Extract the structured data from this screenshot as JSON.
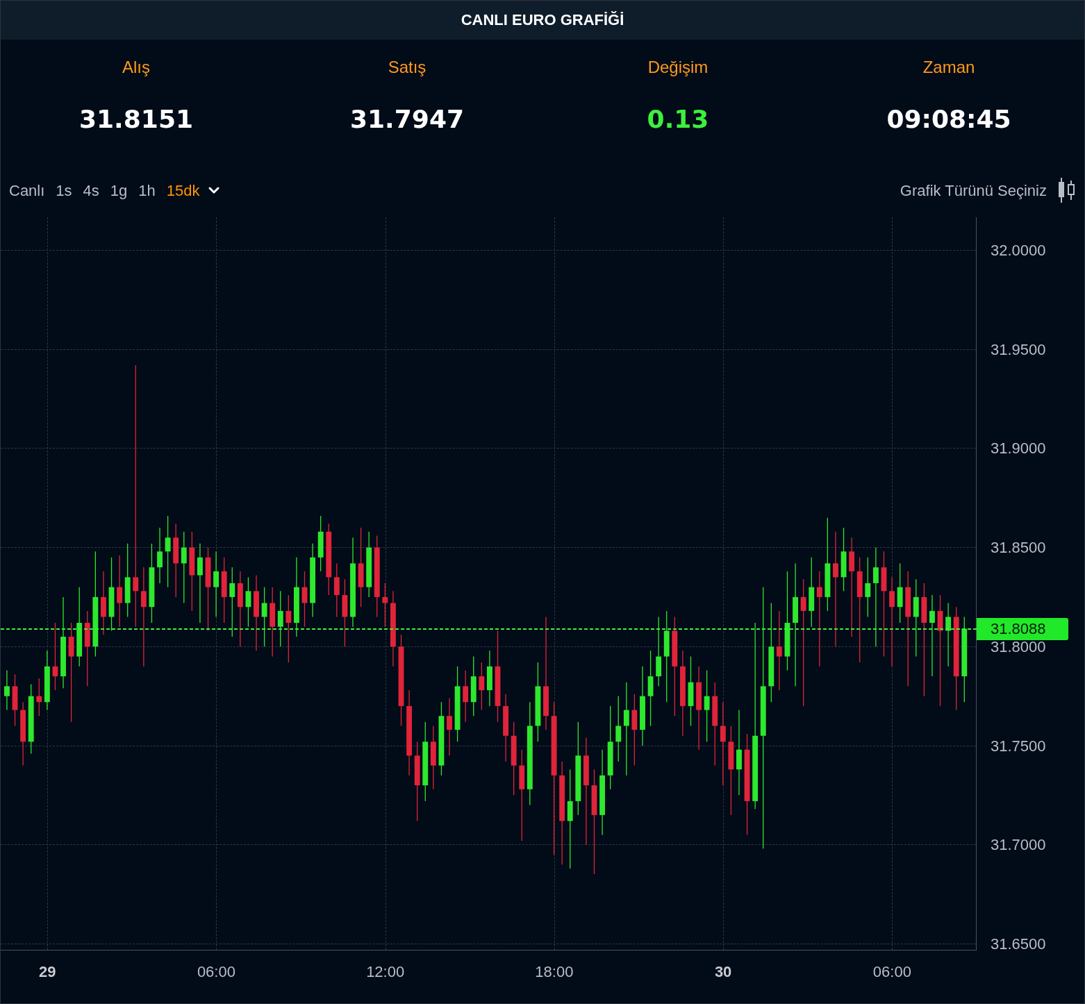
{
  "window": {
    "title": "CANLI EURO GRAFİĞİ"
  },
  "stats": [
    {
      "label": "Alış",
      "value": "31.8151",
      "kind": "plain"
    },
    {
      "label": "Satış",
      "value": "31.7947",
      "kind": "plain"
    },
    {
      "label": "Değişim",
      "value": "0.13",
      "kind": "up"
    },
    {
      "label": "Zaman",
      "value": "09:08:45",
      "kind": "plain"
    }
  ],
  "intervals": [
    {
      "label": "Canlı",
      "selected": false
    },
    {
      "label": "1s",
      "selected": false
    },
    {
      "label": "4s",
      "selected": false
    },
    {
      "label": "1g",
      "selected": false
    },
    {
      "label": "1h",
      "selected": false
    },
    {
      "label": "15dk",
      "selected": true
    }
  ],
  "chart_type_label": "Grafik Türünü Seçiniz",
  "xtick_styles": [
    {
      "bold": true
    },
    {
      "bold": false
    },
    {
      "bold": false
    },
    {
      "bold": false
    },
    {
      "bold": true
    },
    {
      "bold": false
    }
  ],
  "chart_data": {
    "type": "candlestick",
    "grid": true,
    "ref_lines": [
      {
        "axis": "y",
        "value": 31.8088,
        "label": "31.8088",
        "color": "#3cf03c"
      }
    ],
    "ylim": [
      31.65,
      32.0165
    ],
    "categories": [
      null,
      null,
      null,
      null,
      null,
      "29",
      null,
      null,
      null,
      null,
      null,
      null,
      null,
      null,
      null,
      null,
      null,
      null,
      null,
      null,
      null,
      null,
      null,
      null,
      null,
      null,
      "06:00",
      null,
      null,
      null,
      null,
      null,
      null,
      null,
      null,
      null,
      null,
      null,
      null,
      null,
      null,
      null,
      null,
      null,
      null,
      null,
      null,
      "12:00",
      null,
      null,
      null,
      null,
      null,
      null,
      null,
      null,
      null,
      null,
      null,
      null,
      null,
      null,
      null,
      null,
      null,
      null,
      null,
      null,
      "18:00",
      null,
      null,
      null,
      null,
      null,
      null,
      null,
      null,
      null,
      null,
      null,
      null,
      null,
      null,
      null,
      null,
      null,
      null,
      null,
      null,
      "30",
      null,
      null,
      null,
      null,
      null,
      null,
      null,
      null,
      null,
      null,
      null,
      null,
      null,
      null,
      null,
      null,
      null,
      null,
      null,
      null,
      "06:00",
      null,
      null,
      null,
      null,
      null,
      null,
      null,
      null,
      null
    ],
    "yticks": [
      {
        "value": 32.0,
        "label": "32.0000"
      },
      {
        "value": 31.95,
        "label": "31.9500"
      },
      {
        "value": 31.9,
        "label": "31.9000"
      },
      {
        "value": 31.85,
        "label": "31.8500"
      },
      {
        "value": 31.8,
        "label": "31.8000"
      },
      {
        "value": 31.75,
        "label": "31.7500"
      },
      {
        "value": 31.7,
        "label": "31.7000"
      },
      {
        "value": 31.65,
        "label": "31.6500"
      }
    ],
    "ohlc": [
      [
        31.775,
        31.788,
        31.768,
        31.78
      ],
      [
        31.78,
        31.786,
        31.76,
        31.768
      ],
      [
        31.768,
        31.772,
        31.74,
        31.752
      ],
      [
        31.752,
        31.781,
        31.746,
        31.775
      ],
      [
        31.775,
        31.784,
        31.765,
        31.772
      ],
      [
        31.772,
        31.798,
        31.768,
        31.79
      ],
      [
        31.79,
        31.812,
        31.778,
        31.785
      ],
      [
        31.785,
        31.825,
        31.779,
        31.805
      ],
      [
        31.805,
        31.812,
        31.762,
        31.795
      ],
      [
        31.795,
        31.83,
        31.79,
        31.812
      ],
      [
        31.812,
        31.818,
        31.78,
        31.8
      ],
      [
        31.8,
        31.848,
        31.795,
        31.825
      ],
      [
        31.825,
        31.838,
        31.806,
        31.815
      ],
      [
        31.815,
        31.845,
        31.808,
        31.83
      ],
      [
        31.83,
        31.846,
        31.81,
        31.822
      ],
      [
        31.822,
        31.852,
        31.815,
        31.835
      ],
      [
        31.835,
        31.942,
        31.81,
        31.828
      ],
      [
        31.828,
        31.84,
        31.79,
        31.82
      ],
      [
        31.82,
        31.852,
        31.812,
        31.84
      ],
      [
        31.84,
        31.86,
        31.832,
        31.848
      ],
      [
        31.848,
        31.866,
        31.83,
        31.855
      ],
      [
        31.855,
        31.862,
        31.825,
        31.842
      ],
      [
        31.842,
        31.858,
        31.822,
        31.85
      ],
      [
        31.85,
        31.858,
        31.818,
        31.836
      ],
      [
        31.836,
        31.852,
        31.812,
        31.845
      ],
      [
        31.845,
        31.85,
        31.808,
        31.83
      ],
      [
        31.83,
        31.848,
        31.815,
        31.838
      ],
      [
        31.838,
        31.845,
        31.812,
        31.825
      ],
      [
        31.825,
        31.84,
        31.805,
        31.832
      ],
      [
        31.832,
        31.838,
        31.8,
        31.82
      ],
      [
        31.82,
        31.835,
        31.81,
        31.828
      ],
      [
        31.828,
        31.836,
        31.798,
        31.815
      ],
      [
        31.815,
        31.83,
        31.8,
        31.822
      ],
      [
        31.822,
        31.83,
        31.795,
        31.81
      ],
      [
        31.81,
        31.828,
        31.8,
        31.818
      ],
      [
        31.818,
        31.826,
        31.792,
        31.812
      ],
      [
        31.812,
        31.845,
        31.805,
        31.83
      ],
      [
        31.83,
        31.838,
        31.81,
        31.822
      ],
      [
        31.822,
        31.852,
        31.815,
        31.845
      ],
      [
        31.845,
        31.866,
        31.838,
        31.858
      ],
      [
        31.858,
        31.862,
        31.826,
        31.835
      ],
      [
        31.835,
        31.842,
        31.815,
        31.826
      ],
      [
        31.826,
        31.834,
        31.8,
        31.815
      ],
      [
        31.815,
        31.855,
        31.81,
        31.842
      ],
      [
        31.842,
        31.86,
        31.82,
        31.83
      ],
      [
        31.83,
        31.858,
        31.825,
        31.85
      ],
      [
        31.85,
        31.856,
        31.815,
        31.825
      ],
      [
        31.825,
        31.832,
        31.81,
        31.822
      ],
      [
        31.822,
        31.828,
        31.79,
        31.8
      ],
      [
        31.8,
        31.806,
        31.76,
        31.77
      ],
      [
        31.77,
        31.778,
        31.735,
        31.745
      ],
      [
        31.745,
        31.752,
        31.712,
        31.73
      ],
      [
        31.73,
        31.762,
        31.722,
        31.752
      ],
      [
        31.752,
        31.76,
        31.728,
        31.74
      ],
      [
        31.74,
        31.772,
        31.735,
        31.765
      ],
      [
        31.765,
        31.774,
        31.745,
        31.758
      ],
      [
        31.758,
        31.79,
        31.752,
        31.78
      ],
      [
        31.78,
        31.788,
        31.762,
        31.772
      ],
      [
        31.772,
        31.795,
        31.765,
        31.785
      ],
      [
        31.785,
        31.792,
        31.768,
        31.778
      ],
      [
        31.778,
        31.798,
        31.77,
        31.79
      ],
      [
        31.79,
        31.808,
        31.762,
        31.77
      ],
      [
        31.77,
        31.776,
        31.742,
        31.755
      ],
      [
        31.755,
        31.762,
        31.725,
        31.74
      ],
      [
        31.74,
        31.748,
        31.702,
        31.728
      ],
      [
        31.728,
        31.772,
        31.72,
        31.76
      ],
      [
        31.76,
        31.792,
        31.752,
        31.78
      ],
      [
        31.78,
        31.815,
        31.758,
        31.765
      ],
      [
        31.765,
        31.772,
        31.695,
        31.735
      ],
      [
        31.735,
        31.742,
        31.69,
        31.712
      ],
      [
        31.712,
        31.738,
        31.688,
        31.722
      ],
      [
        31.722,
        31.762,
        31.715,
        31.745
      ],
      [
        31.745,
        31.754,
        31.7,
        31.73
      ],
      [
        31.73,
        31.738,
        31.685,
        31.715
      ],
      [
        31.715,
        31.748,
        31.705,
        31.735
      ],
      [
        31.735,
        31.77,
        31.728,
        31.752
      ],
      [
        31.752,
        31.775,
        31.742,
        31.76
      ],
      [
        31.76,
        31.782,
        31.735,
        31.768
      ],
      [
        31.768,
        31.776,
        31.74,
        31.758
      ],
      [
        31.758,
        31.79,
        31.75,
        31.775
      ],
      [
        31.775,
        31.798,
        31.76,
        31.785
      ],
      [
        31.785,
        31.815,
        31.78,
        31.795
      ],
      [
        31.795,
        31.818,
        31.772,
        31.808
      ],
      [
        31.808,
        31.815,
        31.765,
        31.79
      ],
      [
        31.79,
        31.798,
        31.755,
        31.77
      ],
      [
        31.77,
        31.795,
        31.76,
        31.782
      ],
      [
        31.782,
        31.79,
        31.748,
        31.768
      ],
      [
        31.768,
        31.788,
        31.752,
        31.775
      ],
      [
        31.775,
        31.782,
        31.74,
        31.76
      ],
      [
        31.76,
        31.772,
        31.73,
        31.752
      ],
      [
        31.752,
        31.76,
        31.715,
        31.738
      ],
      [
        31.738,
        31.768,
        31.725,
        31.748
      ],
      [
        31.748,
        31.756,
        31.705,
        31.722
      ],
      [
        31.722,
        31.812,
        31.718,
        31.755
      ],
      [
        31.755,
        31.83,
        31.698,
        31.78
      ],
      [
        31.78,
        31.822,
        31.772,
        31.8
      ],
      [
        31.8,
        31.818,
        31.778,
        31.795
      ],
      [
        31.795,
        31.838,
        31.788,
        31.812
      ],
      [
        31.812,
        31.842,
        31.78,
        31.825
      ],
      [
        31.825,
        31.834,
        31.77,
        31.818
      ],
      [
        31.818,
        31.845,
        31.81,
        31.83
      ],
      [
        31.83,
        31.838,
        31.79,
        31.825
      ],
      [
        31.825,
        31.865,
        31.818,
        31.842
      ],
      [
        31.842,
        31.858,
        31.8,
        31.835
      ],
      [
        31.835,
        31.86,
        31.828,
        31.848
      ],
      [
        31.848,
        31.855,
        31.805,
        31.838
      ],
      [
        31.838,
        31.845,
        31.792,
        31.825
      ],
      [
        31.825,
        31.845,
        31.815,
        31.832
      ],
      [
        31.832,
        31.85,
        31.8,
        31.84
      ],
      [
        31.84,
        31.848,
        31.795,
        31.828
      ],
      [
        31.828,
        31.835,
        31.79,
        31.82
      ],
      [
        31.82,
        31.842,
        31.812,
        31.83
      ],
      [
        31.83,
        31.838,
        31.78,
        31.815
      ],
      [
        31.815,
        31.834,
        31.795,
        31.825
      ],
      [
        31.825,
        31.832,
        31.775,
        31.812
      ],
      [
        31.812,
        31.826,
        31.785,
        31.818
      ],
      [
        31.818,
        31.826,
        31.77,
        31.808
      ],
      [
        31.808,
        31.822,
        31.79,
        31.815
      ],
      [
        31.815,
        31.82,
        31.768,
        31.785
      ],
      [
        31.785,
        31.815,
        31.772,
        31.809
      ]
    ]
  }
}
